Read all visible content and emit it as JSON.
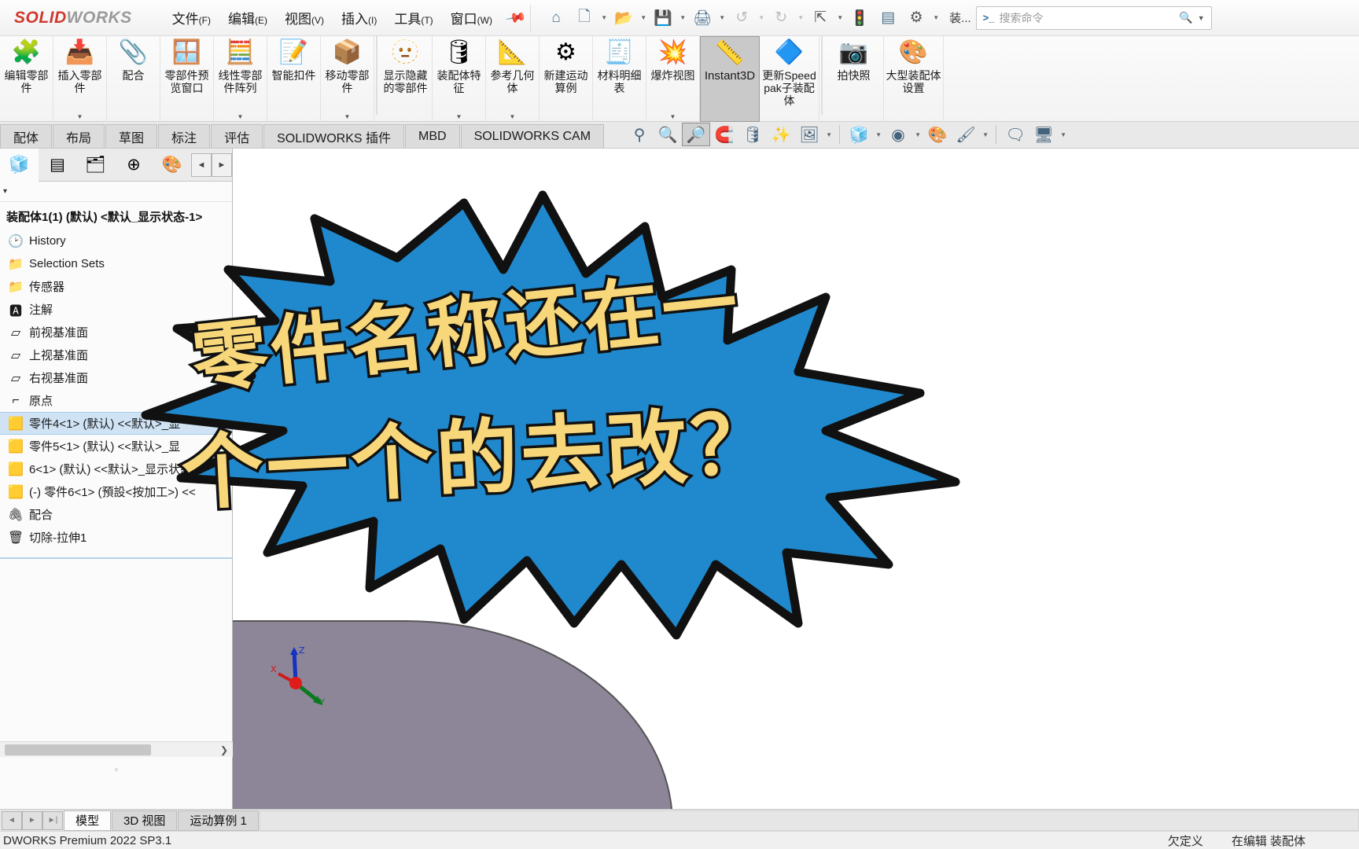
{
  "app": {
    "logo_bold": "SOLID",
    "logo_light": "WORKS",
    "assembly_tag": "装...",
    "version": "DWORKS Premium 2022 SP3.1"
  },
  "menubar": {
    "items": [
      {
        "label": "文件",
        "mnemonic": "(F)"
      },
      {
        "label": "编辑",
        "mnemonic": "(E)"
      },
      {
        "label": "视图",
        "mnemonic": "(V)"
      },
      {
        "label": "插入",
        "mnemonic": "(I)"
      },
      {
        "label": "工具",
        "mnemonic": "(T)"
      },
      {
        "label": "窗口",
        "mnemonic": "(W)"
      }
    ],
    "pin": "pushpin-icon",
    "quick_icons": [
      {
        "name": "home-icon",
        "glyph": "⌂"
      },
      {
        "name": "new-document-icon",
        "glyph": "🗋",
        "has_caret": true
      },
      {
        "name": "open-folder-icon",
        "glyph": "📂",
        "has_caret": true
      },
      {
        "name": "save-icon",
        "glyph": "💾",
        "has_caret": true
      },
      {
        "name": "print-icon",
        "glyph": "🖨",
        "has_caret": true
      },
      {
        "name": "undo-icon",
        "glyph": "↺",
        "has_caret": true,
        "disabled": true
      },
      {
        "name": "redo-icon",
        "glyph": "↻",
        "has_caret": true,
        "disabled": true
      },
      {
        "name": "select-cursor-icon",
        "glyph": "⇱",
        "has_caret": true
      },
      {
        "name": "rebuild-traffic-light-icon",
        "glyph": "🚦"
      },
      {
        "name": "options-list-icon",
        "glyph": "▤"
      },
      {
        "name": "settings-gear-icon",
        "glyph": "⚙",
        "has_caret": true
      }
    ]
  },
  "search": {
    "placeholder": "搜索命令",
    "value": "",
    "prefix_icon": "command-search-icon",
    "magnifier_icon": "search-icon",
    "caret_icon": "chevron-down-icon"
  },
  "ribbon": {
    "buttons": [
      {
        "name": "edit-component",
        "label": "编辑零部件",
        "icon": "edit-component-icon",
        "glyph": "🧩",
        "dropdown": false,
        "active": false
      },
      {
        "name": "insert-components",
        "label": "插入零部件",
        "icon": "insert-component-icon",
        "glyph": "📥",
        "dropdown": true,
        "active": false
      },
      {
        "name": "mate",
        "label": "配合",
        "icon": "paperclip-mate-icon",
        "glyph": "📎",
        "dropdown": false,
        "active": false
      },
      {
        "name": "component-preview-window",
        "label": "零部件预览窗口",
        "icon": "component-preview-icon",
        "glyph": "🪟",
        "dropdown": false,
        "active": false
      },
      {
        "name": "linear-component-pattern",
        "label": "线性零部件阵列",
        "icon": "linear-pattern-icon",
        "glyph": "🧮",
        "dropdown": true,
        "active": false
      },
      {
        "name": "smart-fasteners",
        "label": "智能扣件",
        "icon": "smart-fastener-icon",
        "glyph": "📝",
        "dropdown": false,
        "active": false
      },
      {
        "name": "move-component",
        "label": "移动零部件",
        "icon": "move-component-icon",
        "glyph": "📦",
        "dropdown": true,
        "active": false
      },
      {
        "name": "show-hidden-components",
        "label": "显示隐藏的零部件",
        "icon": "show-hidden-icon",
        "glyph": "🫥",
        "dropdown": false,
        "active": false
      },
      {
        "name": "assembly-features",
        "label": "装配体特征",
        "icon": "assembly-feature-icon",
        "glyph": "🛢",
        "dropdown": true,
        "active": false
      },
      {
        "name": "reference-geometry",
        "label": "参考几何体",
        "icon": "reference-geometry-icon",
        "glyph": "📐",
        "dropdown": true,
        "active": false
      },
      {
        "name": "new-motion-study",
        "label": "新建运动算例",
        "icon": "motion-study-icon",
        "glyph": "⚙",
        "dropdown": false,
        "active": false
      },
      {
        "name": "bill-of-materials",
        "label": "材料明细表",
        "icon": "bom-table-icon",
        "glyph": "🧾",
        "dropdown": false,
        "active": false
      },
      {
        "name": "exploded-view",
        "label": "爆炸视图",
        "icon": "exploded-view-icon",
        "glyph": "💥",
        "dropdown": true,
        "active": false
      },
      {
        "name": "instant3d",
        "label": "Instant3D",
        "icon": "instant3d-icon",
        "glyph": "📏",
        "dropdown": false,
        "active": true,
        "latin": true
      },
      {
        "name": "update-speedpak",
        "label": "更新Speedpak子装配体",
        "icon": "speedpak-icon",
        "glyph": "🔷",
        "dropdown": false,
        "active": false
      },
      {
        "name": "take-snapshot",
        "label": "拍快照",
        "icon": "camera-icon",
        "glyph": "📷",
        "dropdown": false,
        "active": false
      },
      {
        "name": "large-assembly-settings",
        "label": "大型装配体设置",
        "icon": "large-assembly-icon",
        "glyph": "🎨",
        "dropdown": false,
        "active": false
      }
    ]
  },
  "command_tabs": {
    "items": [
      {
        "label": "配体",
        "selected": false,
        "partial": true
      },
      {
        "label": "布局",
        "selected": false
      },
      {
        "label": "草图",
        "selected": false
      },
      {
        "label": "标注",
        "selected": false
      },
      {
        "label": "评估",
        "selected": false
      },
      {
        "label": "SOLIDWORKS 插件",
        "selected": false
      },
      {
        "label": "MBD",
        "selected": false
      },
      {
        "label": "SOLIDWORKS CAM",
        "selected": false
      }
    ],
    "view_tools": [
      {
        "name": "section-view-icon",
        "glyph": "⚲",
        "boxed": false
      },
      {
        "name": "zoom-fit-icon",
        "glyph": "🔍",
        "boxed": false
      },
      {
        "name": "zoom-to-area-icon",
        "glyph": "🔎",
        "boxed": true
      },
      {
        "name": "view-orientation-icon",
        "glyph": "🧲",
        "boxed": false
      },
      {
        "name": "display-style-icon",
        "glyph": "🛢",
        "boxed": false
      },
      {
        "name": "apply-scene-icon",
        "glyph": "✨",
        "boxed": false
      },
      {
        "name": "hide-show-items-icon",
        "glyph": "🖼",
        "boxed": false,
        "caret": true
      },
      {
        "name": "view-settings-icon",
        "glyph": "🧊",
        "boxed": false,
        "caret": true
      },
      {
        "name": "display-state-icon",
        "glyph": "◉",
        "boxed": false,
        "caret": true
      },
      {
        "name": "appearances-icon",
        "glyph": "🎨",
        "boxed": false
      },
      {
        "name": "scene-icon",
        "glyph": "🖌",
        "boxed": false,
        "caret": true
      },
      {
        "name": "publish-icon",
        "glyph": "🗨",
        "boxed": false
      },
      {
        "name": "viewport-icon",
        "glyph": "🖥",
        "boxed": false,
        "caret": true
      }
    ]
  },
  "feature_manager": {
    "tabs": [
      {
        "name": "feature-manager-tree-tab",
        "glyph": "🧊",
        "selected": true
      },
      {
        "name": "property-manager-tab",
        "glyph": "▤",
        "selected": false
      },
      {
        "name": "configuration-manager-tab",
        "glyph": "🗂",
        "selected": false
      },
      {
        "name": "dimxpert-manager-tab",
        "glyph": "⊕",
        "selected": false
      },
      {
        "name": "display-manager-tab",
        "glyph": "🎨",
        "selected": false
      }
    ],
    "nav_left": "◄",
    "nav_right": "►",
    "filter_caret": "▾",
    "tree_root": "装配体1(1) (默认) <默认_显示状态-1>",
    "tree_items": [
      {
        "label": "History",
        "icon": "history-folder-icon",
        "glyph": "🕑",
        "selected": false,
        "indent": 0
      },
      {
        "label": "Selection Sets",
        "icon": "selection-sets-folder-icon",
        "glyph": "📁",
        "selected": false,
        "indent": 0
      },
      {
        "label": "传感器",
        "icon": "sensors-folder-icon",
        "glyph": "📁",
        "selected": false,
        "indent": 0
      },
      {
        "label": "注解",
        "icon": "annotations-folder-icon",
        "glyph": "🅰",
        "selected": false,
        "indent": 0
      },
      {
        "label": "前视基准面",
        "icon": "front-plane-icon",
        "glyph": "▱",
        "selected": false,
        "indent": 0
      },
      {
        "label": "上视基准面",
        "icon": "top-plane-icon",
        "glyph": "▱",
        "selected": false,
        "indent": 0
      },
      {
        "label": "右视基准面",
        "icon": "right-plane-icon",
        "glyph": "▱",
        "selected": false,
        "indent": 0
      },
      {
        "label": "原点",
        "icon": "origin-icon",
        "glyph": "⌐",
        "selected": false,
        "indent": 0
      },
      {
        "label": "零件4<1> (默认) <<默认>_显",
        "icon": "component-icon",
        "glyph": "🟨",
        "selected": true,
        "indent": 0
      },
      {
        "label": "零件5<1> (默认) <<默认>_显",
        "icon": "component-icon",
        "glyph": "🟨",
        "selected": false,
        "indent": 0
      },
      {
        "label": "6<1> (默认) <<默认>_显示状态",
        "icon": "component-icon",
        "glyph": "🟨",
        "selected": false,
        "indent": 0
      },
      {
        "label": "(-) 零件6<1> (預設<按加工>) <<",
        "icon": "component-icon",
        "glyph": "🟨",
        "selected": false,
        "indent": 0
      },
      {
        "label": "配合",
        "icon": "mates-folder-icon",
        "glyph": "🖇",
        "selected": false,
        "indent": 0
      },
      {
        "label": "切除-拉伸1",
        "icon": "extrude-cut-icon",
        "glyph": "🗑",
        "selected": false,
        "indent": 0
      }
    ]
  },
  "sticker": {
    "line1": "零件名称还在一",
    "line2": "个一个的去改？",
    "fill_color": "#2089cd",
    "stroke_color": "#111111",
    "text_color": "#f7d77a"
  },
  "bottom_tabs": {
    "nav": [
      "◄",
      "►",
      "►|"
    ],
    "items": [
      {
        "label": "模型",
        "selected": true
      },
      {
        "label": "3D 视图",
        "selected": false
      },
      {
        "label": "运动算例 1",
        "selected": false
      }
    ]
  },
  "statusbar": {
    "left": "DWORKS Premium 2022 SP3.1",
    "state": "欠定义",
    "mode": "在编辑 装配体"
  }
}
